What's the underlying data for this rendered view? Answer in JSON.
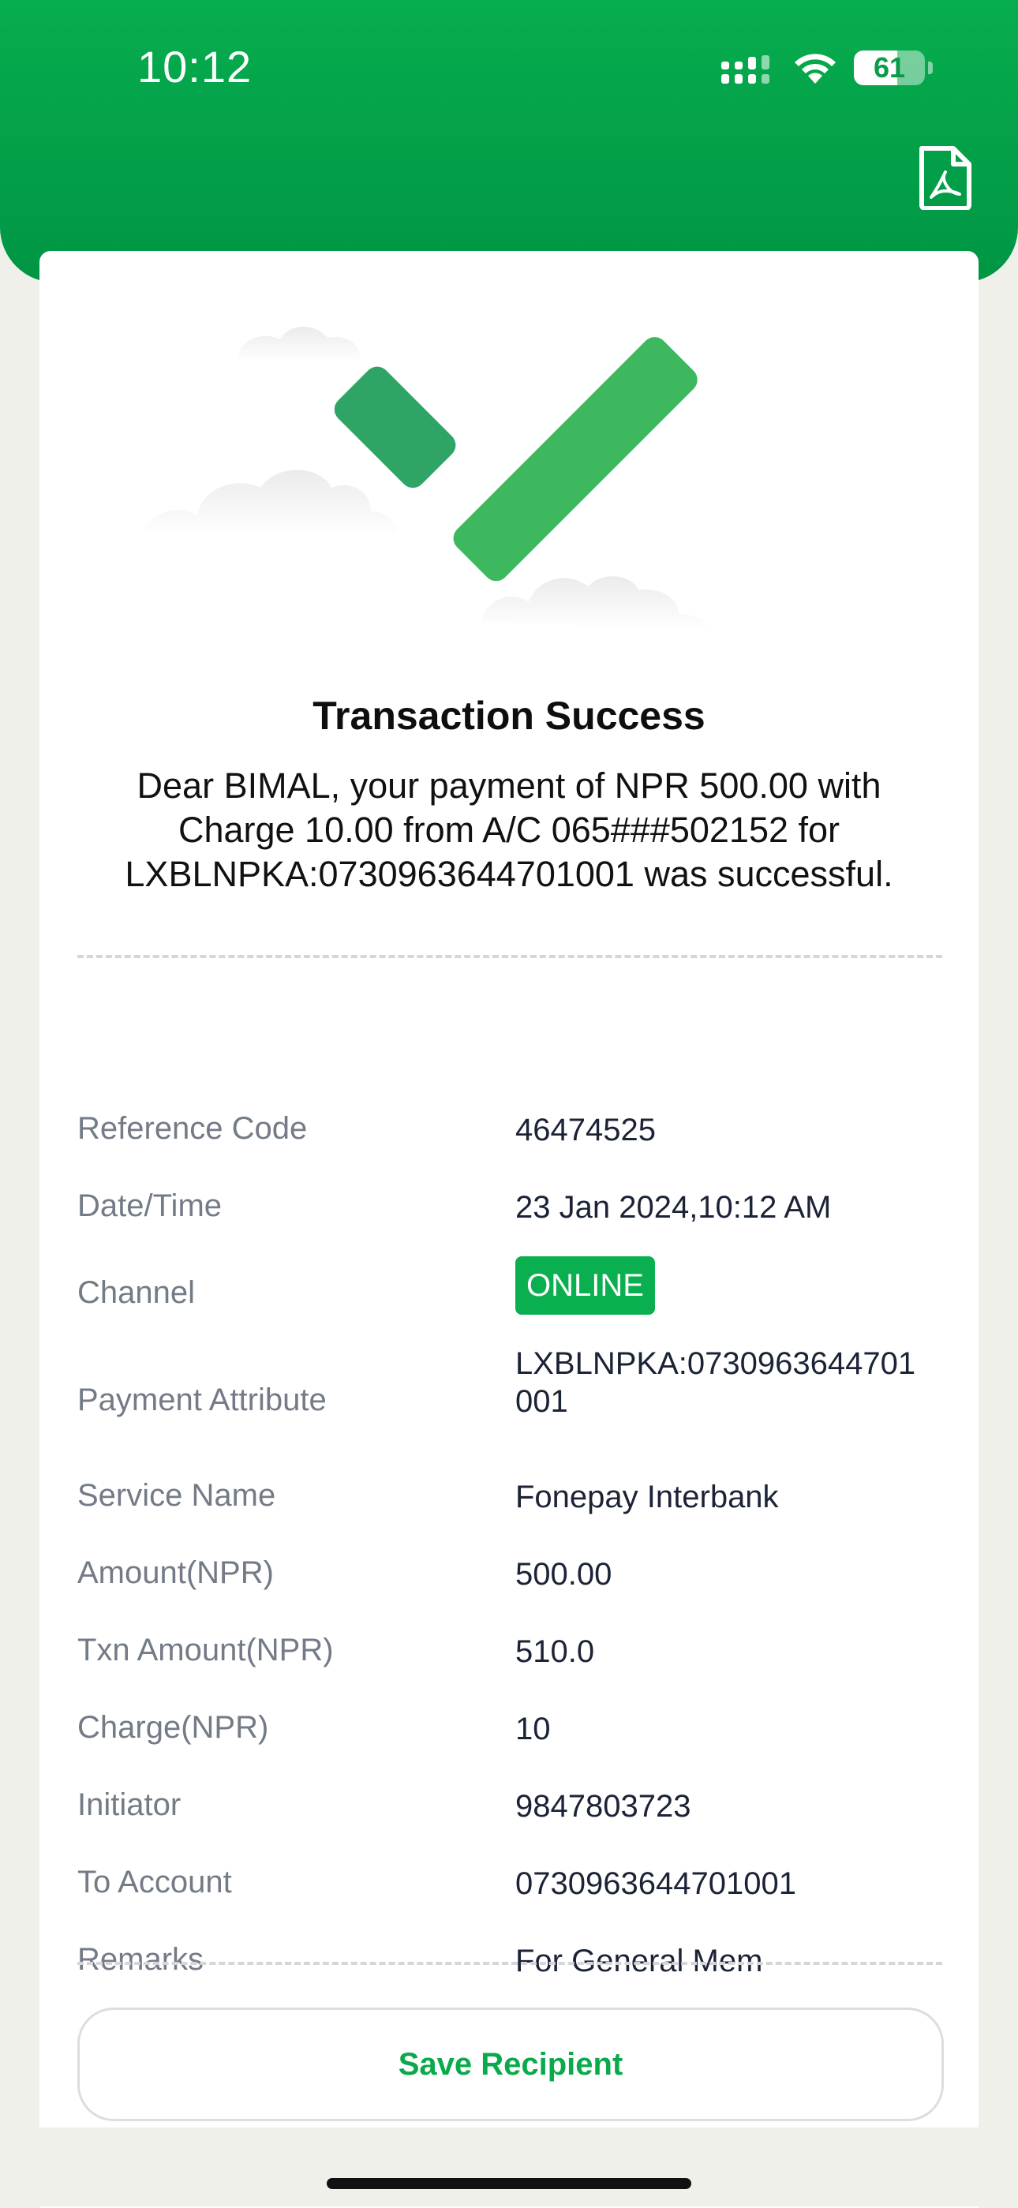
{
  "status_bar": {
    "time": "10:12",
    "battery": "61",
    "battery_level": 0.61
  },
  "header": {
    "pdf_icon": "pdf-file-icon",
    "background_color": "#07ad4e"
  },
  "result": {
    "icon": "success-checkmark-icon",
    "title": "Transaction Success",
    "message": "Dear BIMAL, your payment of NPR 500.00 with Charge 10.00 from A/C 065###502152 for LXBLNPKA:0730963644701001 was successful."
  },
  "details": [
    {
      "label": "Reference Code",
      "value": "46474525"
    },
    {
      "label": "Date/Time",
      "value": "23 Jan 2024,10:12 AM"
    },
    {
      "label": "Channel",
      "value": "ONLINE"
    },
    {
      "label": "Payment Attribute",
      "value": "LXBLNPKA:0730963644701\n001"
    },
    {
      "label": "Service Name",
      "value": "Fonepay Interbank"
    },
    {
      "label": "Amount(NPR)",
      "value": "500.00"
    },
    {
      "label": "Txn Amount(NPR)",
      "value": "510.0"
    },
    {
      "label": "Charge(NPR)",
      "value": "10"
    },
    {
      "label": "Initiator",
      "value": "9847803723"
    },
    {
      "label": "To Account",
      "value": "0730963644701001"
    },
    {
      "label": "Remarks",
      "value": "For General Mem"
    }
  ],
  "actions": {
    "save_recipient": "Save Recipient"
  },
  "colors": {
    "accent": "#0aaf4f",
    "label_text": "#737b86",
    "value_text": "#1b2336"
  }
}
